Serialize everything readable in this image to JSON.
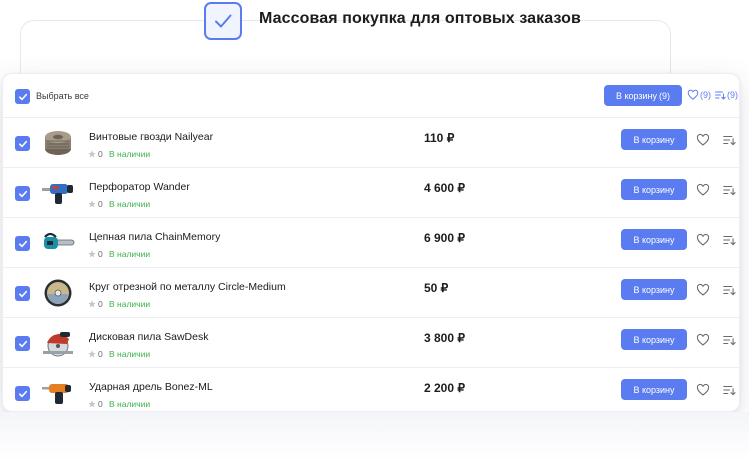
{
  "header": {
    "title": "Массовая покупка для оптовых заказов"
  },
  "toolbar": {
    "select_all_label": "Выбрать все",
    "cart_all_label": "В корзину",
    "cart_all_count": "(9)",
    "favorites_count": "(9)",
    "compare_count": "(9)"
  },
  "products": [
    {
      "name": "Винтовые гвозди Nailyear",
      "rating": "0",
      "stock": "В наличии",
      "price": "110 ₽",
      "button": "В корзину",
      "icon": "nails-icon"
    },
    {
      "name": "Перфоратор Wander",
      "rating": "0",
      "stock": "В наличии",
      "price": "4 600 ₽",
      "button": "В корзину",
      "icon": "rotary-hammer-icon"
    },
    {
      "name": "Цепная пила ChainMemory",
      "rating": "0",
      "stock": "В наличии",
      "price": "6 900 ₽",
      "button": "В корзину",
      "icon": "chainsaw-icon"
    },
    {
      "name": "Круг отрезной по металлу Circle-Medium",
      "rating": "0",
      "stock": "В наличии",
      "price": "50 ₽",
      "button": "В корзину",
      "icon": "cutting-disc-icon"
    },
    {
      "name": "Дисковая пила SawDesk",
      "rating": "0",
      "stock": "В наличии",
      "price": "3 800 ₽",
      "button": "В корзину",
      "icon": "circular-saw-icon"
    },
    {
      "name": "Ударная дрель Bonez-ML",
      "rating": "0",
      "stock": "В наличии",
      "price": "2 200 ₽",
      "button": "В корзину",
      "icon": "impact-drill-icon"
    }
  ],
  "colors": {
    "accent": "#5b7cf0",
    "stock": "#3bb34a"
  }
}
